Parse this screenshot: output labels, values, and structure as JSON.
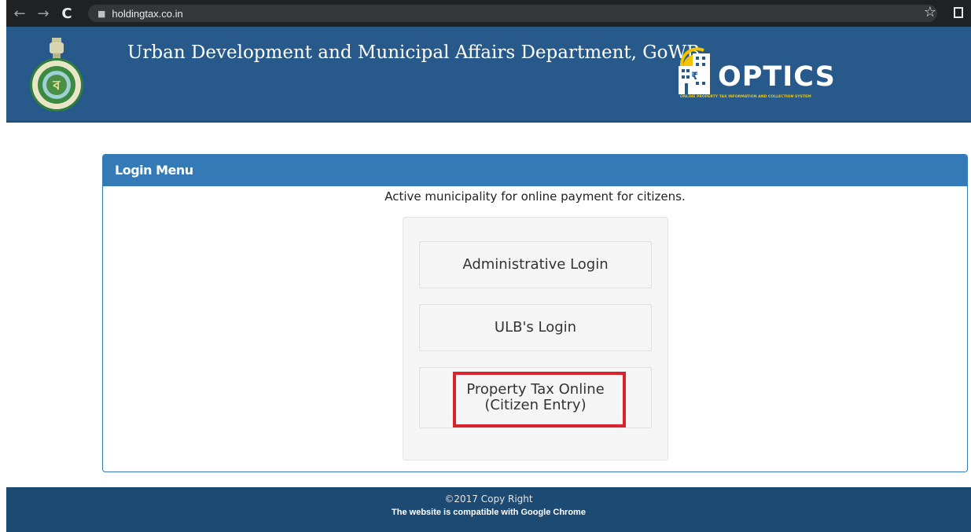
{
  "browser": {
    "back_icon": "←",
    "forward_icon": "→",
    "reload_icon": "C",
    "url": "holdingtax.co.in",
    "star_icon": "☆"
  },
  "header": {
    "title": "Urban Development and Municipal Affairs Department, GoWB.",
    "logo_text": "OPTICS",
    "logo_tagline": "ONLINE PROPERTY TAX INFORMATION AND COLLECTION SYSTEM",
    "background_color": "#275a8a"
  },
  "login_panel": {
    "heading": "Login Menu",
    "subtitle": "Active municipality for online payment for citizens.",
    "buttons": [
      {
        "label": "Administrative Login"
      },
      {
        "label": "ULB's Login"
      },
      {
        "label_line1": "Property Tax Online",
        "label_line2": "(Citizen Entry)"
      }
    ],
    "highlight_color": "#d9232d",
    "accent_color": "#337ab7"
  },
  "footer": {
    "copyright": "©2017 Copy Right",
    "compatibility": "The website is compatible with Google Chrome",
    "background_color": "#1c4a72"
  }
}
